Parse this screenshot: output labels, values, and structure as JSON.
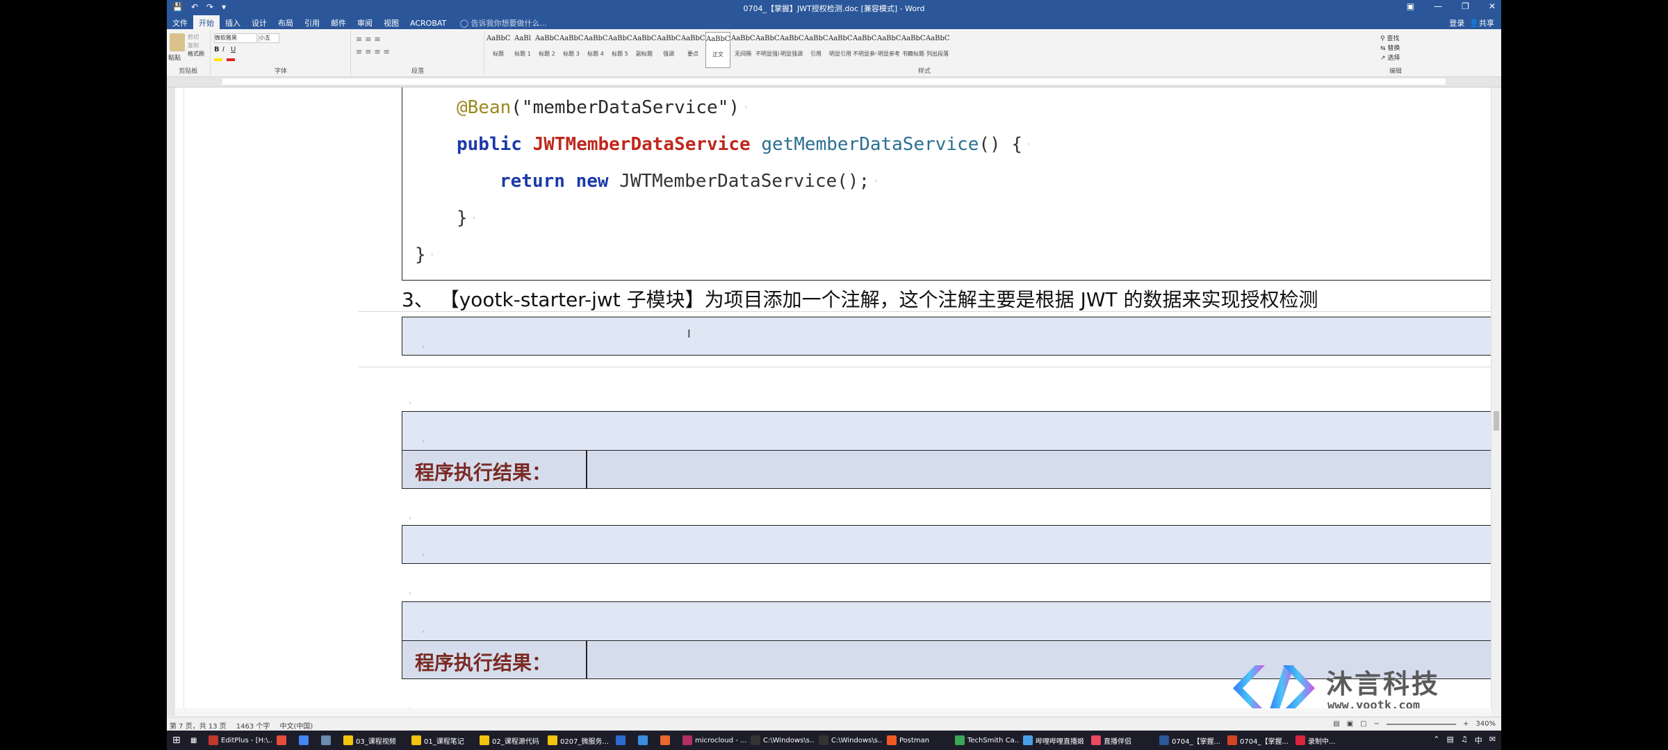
{
  "window": {
    "title": "0704_【掌握】JWT授权检测.doc [兼容模式] - Word",
    "qat_icons": [
      "save-icon",
      "undo-icon",
      "redo-icon",
      "customize-icon"
    ],
    "controls": [
      "ribbon-display-icon",
      "minimize-icon",
      "restore-icon",
      "close-icon"
    ]
  },
  "tabs": {
    "items": [
      "文件",
      "开始",
      "插入",
      "设计",
      "布局",
      "引用",
      "邮件",
      "审阅",
      "视图",
      "ACROBAT"
    ],
    "active": "开始",
    "tell_me": "告诉我你想要做什么...",
    "login": "登录",
    "share": "共享"
  },
  "ribbon": {
    "clipboard": {
      "paste": "粘贴",
      "cut": "剪切",
      "copy": "复制",
      "format_painter": "格式刷",
      "label": "剪贴板"
    },
    "font": {
      "name": "微软雅黑",
      "size": "小五",
      "label": "字体"
    },
    "paragraph": {
      "label": "段落"
    },
    "styles": {
      "label": "样式",
      "items": [
        {
          "preview": "AaBbC",
          "name": "标题"
        },
        {
          "preview": "AaBl",
          "name": "标题 1"
        },
        {
          "preview": "AaBbC",
          "name": "标题 2"
        },
        {
          "preview": "AaBbC",
          "name": "标题 3"
        },
        {
          "preview": "AaBbC",
          "name": "标题 4"
        },
        {
          "preview": "AaBbC",
          "name": "标题 5"
        },
        {
          "preview": "AaBbC",
          "name": "副标题"
        },
        {
          "preview": "AaBbCcDc",
          "name": "强调"
        },
        {
          "preview": "AaBbCcD",
          "name": "要点"
        },
        {
          "preview": "AaBbCcDc",
          "name": "正文"
        },
        {
          "preview": "AaBbCcDc",
          "name": "无间隔"
        },
        {
          "preview": "AaBbCcDc",
          "name": "不明显强调"
        },
        {
          "preview": "AaBbCcDc",
          "name": "明显强调"
        },
        {
          "preview": "AaBbCcDc",
          "name": "引用"
        },
        {
          "preview": "AaBbCcDc",
          "name": "明显引用"
        },
        {
          "preview": "AaBbCcD",
          "name": "不明显参考"
        },
        {
          "preview": "AaBbCcI",
          "name": "明显参考"
        },
        {
          "preview": "AaBbCcD",
          "name": "书籍标题"
        },
        {
          "preview": "AaBbCcDc",
          "name": "列出段落"
        }
      ]
    },
    "editing": {
      "find": "查找",
      "replace": "替换",
      "select": "选择",
      "label": "编辑"
    }
  },
  "document": {
    "code_lines": [
      {
        "annotation": "@Bean",
        "rest": "(\"memberDataService\")"
      },
      {
        "kw": "public",
        "cls": "JWTMemberDataService",
        "method": "getMemberDataService",
        "tail": "() {"
      },
      {
        "kw1": "return",
        "kw2": "new",
        "tail": "JWTMemberDataService();"
      },
      {
        "text": "}"
      },
      {
        "text": "}"
      }
    ],
    "step_text": "3、  【yootk-starter-jwt 子模块】为项目添加一个注解，这个注解主要是根据 JWT 的数据来实现授权检测",
    "result_label": "程序执行结果："
  },
  "watermark": {
    "brand": "沐言科技",
    "url": "www.yootk.com"
  },
  "status": {
    "page": "第 7 页，共 13 页",
    "words": "1463 个字",
    "language": "中文(中国)",
    "zoom": "340%"
  },
  "taskbar": {
    "items": [
      {
        "label": "EditPlus - [H:\\...",
        "color": "#c0392b"
      },
      {
        "label": "",
        "color": "#e74c3c"
      },
      {
        "label": "",
        "color": "#4285f4"
      },
      {
        "label": "",
        "color": "#6a8caf"
      },
      {
        "label": "03_课程视频",
        "color": "#f1c40f"
      },
      {
        "label": "01_课程笔记",
        "color": "#f1c40f"
      },
      {
        "label": "02_课程源代码",
        "color": "#f1c40f"
      },
      {
        "label": "0207_微服务...",
        "color": "#f1c40f"
      },
      {
        "label": "",
        "color": "#2c6bd1"
      },
      {
        "label": "",
        "color": "#3b8ede"
      },
      {
        "label": "",
        "color": "#e8692e"
      },
      {
        "label": "microcloud - ...",
        "color": "#b03060"
      },
      {
        "label": "C:\\Windows\\s...",
        "color": "#333333"
      },
      {
        "label": "C:\\Windows\\s...",
        "color": "#333333"
      },
      {
        "label": "Postman",
        "color": "#ef5b25"
      },
      {
        "label": "TechSmith Ca...",
        "color": "#3aa757"
      },
      {
        "label": "哔哩哔哩直播姬",
        "color": "#4aa0e6"
      },
      {
        "label": "直播伴侣",
        "color": "#e84a5f"
      },
      {
        "label": "0704_【掌握...",
        "color": "#2b579a"
      },
      {
        "label": "0704_【掌握...",
        "color": "#d04423"
      },
      {
        "label": "录制中...",
        "color": "#d7263d"
      }
    ],
    "time": "",
    "tray_icons": [
      "chevron-up-icon",
      "network-icon",
      "volume-icon",
      "ime-icon",
      "notification-icon"
    ]
  }
}
